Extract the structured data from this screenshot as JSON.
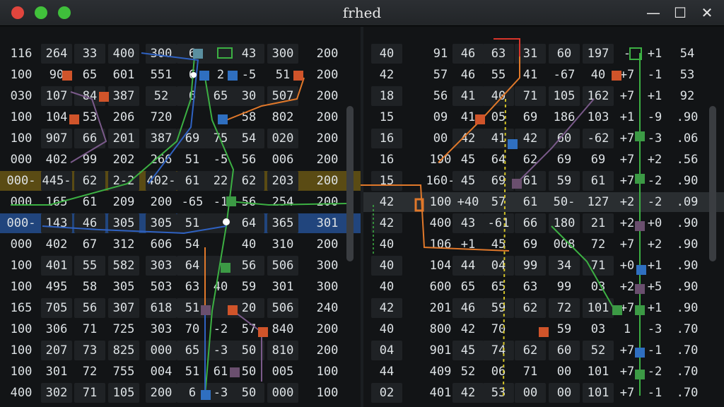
{
  "window": {
    "title": "frhed"
  },
  "titlebar": {
    "minimize_glyph": "—",
    "maximize_glyph": "☐",
    "close_glyph": "✕"
  },
  "left_rows": [
    [
      "116",
      "264",
      "33",
      "400",
      "300",
      "6",
      "",
      "43",
      "300",
      "200"
    ],
    [
      "100",
      "90",
      "65",
      "601",
      "551",
      "6",
      "2",
      "-5",
      "51",
      "200"
    ],
    [
      "030",
      "107",
      "84",
      "387",
      "52",
      "6",
      "65",
      "30",
      "507",
      "200"
    ],
    [
      "100",
      "104",
      "53",
      "206",
      "720",
      "",
      "",
      "58",
      "802",
      "200"
    ],
    [
      "100",
      "907",
      "66",
      "201",
      "387",
      "69",
      "75",
      "54",
      "020",
      "200"
    ],
    [
      "000",
      "402",
      "99",
      "202",
      "266",
      "51",
      "-5",
      "56",
      "006",
      "200"
    ],
    [
      "000-",
      "445-",
      "62",
      "2-2",
      "402-",
      "61",
      "22",
      "62",
      "203",
      "200"
    ],
    [
      "000",
      "165",
      "61",
      "209",
      "200",
      "-65",
      "-1",
      "56",
      "254",
      "200"
    ],
    [
      "000-",
      "143",
      "46",
      "305",
      "305",
      "51",
      "",
      "64",
      "365",
      "301"
    ],
    [
      "000",
      "402",
      "67",
      "312",
      "606",
      "54",
      "",
      "40",
      "310",
      "200"
    ],
    [
      "100",
      "401",
      "55",
      "582",
      "303",
      "64",
      "",
      "56",
      "506",
      "300"
    ],
    [
      "100",
      "495",
      "58",
      "305",
      "503",
      "63",
      "40",
      "59",
      "301",
      "300"
    ],
    [
      "165",
      "705",
      "56",
      "307",
      "618",
      "51",
      "",
      "20",
      "506",
      "240"
    ],
    [
      "100",
      "306",
      "71",
      "725",
      "303",
      "70",
      "-2",
      "57",
      "840",
      "200"
    ],
    [
      "100",
      "207",
      "73",
      "825",
      "000",
      "65",
      "-3",
      "50",
      "810",
      "200"
    ],
    [
      "100",
      "301",
      "72",
      "755",
      "004",
      "51",
      "61",
      "50",
      "005",
      "100"
    ],
    [
      "400",
      "302",
      "71",
      "105",
      "200",
      "6",
      "-3",
      "50",
      "000",
      "100"
    ]
  ],
  "right_rows": [
    [
      "40",
      "91",
      "46",
      "63",
      "31",
      "60",
      "197",
      "-",
      "+1",
      "54"
    ],
    [
      "42",
      "57",
      "46",
      "55",
      "41",
      "-67",
      "40",
      "+7",
      "-1",
      "53"
    ],
    [
      "18",
      "56",
      "41",
      "40",
      "71",
      "105",
      "162",
      "+7",
      "+1",
      "92"
    ],
    [
      "15",
      "09",
      "41",
      "05",
      "69",
      "186",
      "103",
      "+1",
      "-9",
      ".90"
    ],
    [
      "16",
      "00",
      "42",
      "41",
      "42",
      "60",
      "-62",
      "+7",
      "-3",
      ".06"
    ],
    [
      "16",
      "190",
      "45",
      "64",
      "62",
      "69",
      "69",
      "+7",
      "+2",
      ".56"
    ],
    [
      "15",
      "160-",
      "45",
      "69",
      "61",
      "59",
      "61",
      "+7",
      "-2",
      ".90"
    ],
    [
      "42",
      "100",
      "+40",
      "57",
      "61",
      "50-",
      "127",
      "+2",
      "-2",
      ".09"
    ],
    [
      "42",
      "400",
      "43",
      "-61",
      "66",
      "180",
      "21",
      "+2",
      "+0",
      ".90"
    ],
    [
      "40",
      "106",
      "+1",
      "45",
      "69",
      "008",
      "72",
      "+7",
      "+2",
      ".90"
    ],
    [
      "40",
      "104",
      "44",
      "04",
      "99",
      "34",
      "71",
      "+0",
      "+1",
      ".90"
    ],
    [
      "40",
      "600",
      "65",
      "65",
      "63",
      "99",
      "03",
      "+2",
      "+5",
      ".90"
    ],
    [
      "42",
      "201",
      "46",
      "59",
      "62",
      "72",
      "101",
      "+7",
      "+1",
      ".90"
    ],
    [
      "40",
      "800",
      "42",
      "70",
      "",
      "59",
      "03",
      "1",
      "-3",
      ".70"
    ],
    [
      "04",
      "901",
      "45",
      "74",
      "62",
      "60",
      "52",
      "+7",
      "-1",
      ".70"
    ],
    [
      "44",
      "409",
      "52",
      "06",
      "71",
      "00",
      "101",
      "+7",
      "-2",
      ".70"
    ],
    [
      "02",
      "401",
      "42",
      "53",
      "00",
      "00",
      "101",
      "+7",
      "-1",
      ".70"
    ]
  ],
  "highlights": {
    "left_yellow_row": 6,
    "left_blue_row": 8,
    "right_gray_row": 7
  },
  "colors": {
    "red_marker": "#d0542a",
    "blue_marker": "#2f6fc0",
    "green_marker": "#3c9a45",
    "purple_marker": "#6a4f6e",
    "trace_green": "#3cb043",
    "trace_blue": "#2f62c2",
    "trace_orange": "#e0782a",
    "trace_red": "#d8352a",
    "trace_purple": "#7a5a8a",
    "trace_yellow": "#d2c228"
  }
}
